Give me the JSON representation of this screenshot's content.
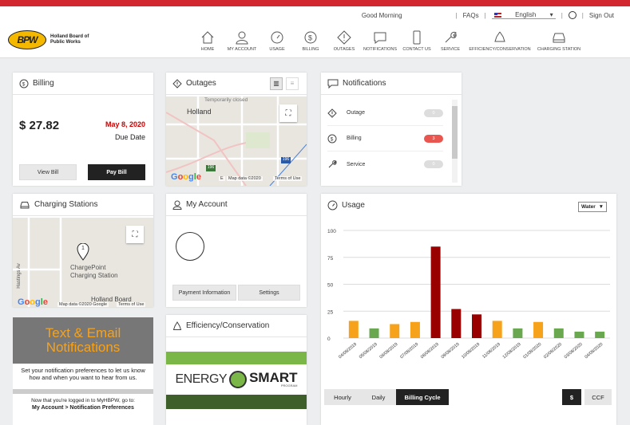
{
  "header": {
    "greeting": "Good Morning",
    "faqs": "FAQs",
    "language": "English",
    "sign_out": "Sign Out",
    "logo_mark": "BPW",
    "logo_text_line1": "Holland Board of",
    "logo_text_line2": "Public Works",
    "nav": [
      {
        "label": "HOME",
        "icon": "home-icon"
      },
      {
        "label": "MY ACCOUNT",
        "icon": "person-icon"
      },
      {
        "label": "USAGE",
        "icon": "gauge-icon"
      },
      {
        "label": "BILLING",
        "icon": "dollar-icon"
      },
      {
        "label": "OUTAGES",
        "icon": "warning-icon"
      },
      {
        "label": "NOTIFICATIONS",
        "icon": "chat-icon"
      },
      {
        "label": "CONTACT US",
        "icon": "phone-icon"
      },
      {
        "label": "SERVICE",
        "icon": "wrench-icon"
      },
      {
        "label": "EFFICIENCY/CONSERVATION",
        "icon": "recycle-icon"
      },
      {
        "label": "CHARGING STATION",
        "icon": "car-icon"
      }
    ]
  },
  "billing": {
    "title": "Billing",
    "amount": "$  27.82",
    "due_date": "May 8, 2020",
    "due_label": "Due Date",
    "view_bill": "View Bill",
    "pay_bill": "Pay Bill"
  },
  "outages": {
    "title": "Outages",
    "map_city": "Holland",
    "map_closed": "Temporarily closed",
    "map_data": "Map data ©2020",
    "terms": "Terms of Use",
    "road1": "196",
    "road2": "196",
    "e": "E"
  },
  "notifications": {
    "title": "Notifications",
    "items": [
      {
        "label": "Outage",
        "count": "0",
        "color": "#dddddd"
      },
      {
        "label": "Billing",
        "count": "3",
        "color": "#e8564f"
      },
      {
        "label": "Service",
        "count": "0",
        "color": "#dddddd"
      }
    ]
  },
  "charging": {
    "title": "Charging Stations",
    "marker": "1",
    "station_line1": "ChargePoint",
    "station_line2": "Charging Station",
    "street": "Hastings Av",
    "place": "Holland Board",
    "map_data": "Map data ©2020 Google",
    "terms": "Terms of Use"
  },
  "account": {
    "title": "My Account",
    "payment_info": "Payment Information",
    "settings": "Settings"
  },
  "efficiency": {
    "title": "Efficiency/Conservation",
    "energy_word": "ENERGY",
    "smart_word": "SMART",
    "program_word": "PROGRAM"
  },
  "promo": {
    "title_line1": "Text & Email",
    "title_line2": "Notifications",
    "body": "Set your notification preferences to let us know how and when you want to hear from us.",
    "foot1": "Now that you're logged in to MyHBPW, go to:",
    "foot2": "My Account > Notification Preferences"
  },
  "usage": {
    "title": "Usage",
    "utility": "Water",
    "tabs": [
      "Hourly",
      "Daily",
      "Billing Cycle"
    ],
    "active_tab": "Billing Cycle",
    "unit_buttons": [
      "$",
      "CCF"
    ]
  },
  "chart_data": {
    "type": "bar",
    "categories": [
      "04/08/2019",
      "05/08/2019",
      "06/08/2019",
      "07/08/2019",
      "08/08/2019",
      "09/08/2019",
      "10/08/2019",
      "11/08/2019",
      "12/08/2019",
      "01/08/2020",
      "02/08/2020",
      "03/08/2020",
      "04/08/2020"
    ],
    "values": [
      16,
      9,
      13,
      15,
      85,
      27,
      22,
      16,
      9,
      15,
      9,
      6,
      6
    ],
    "colors": [
      "#f7a21b",
      "#6aa84f",
      "#f7a21b",
      "#f7a21b",
      "#990000",
      "#990000",
      "#990000",
      "#f7a21b",
      "#6aa84f",
      "#f7a21b",
      "#6aa84f",
      "#6aa84f",
      "#6aa84f"
    ],
    "yticks": [
      "0",
      "25",
      "50",
      "75",
      "100"
    ],
    "ylim": [
      0,
      100
    ],
    "grid": true
  }
}
